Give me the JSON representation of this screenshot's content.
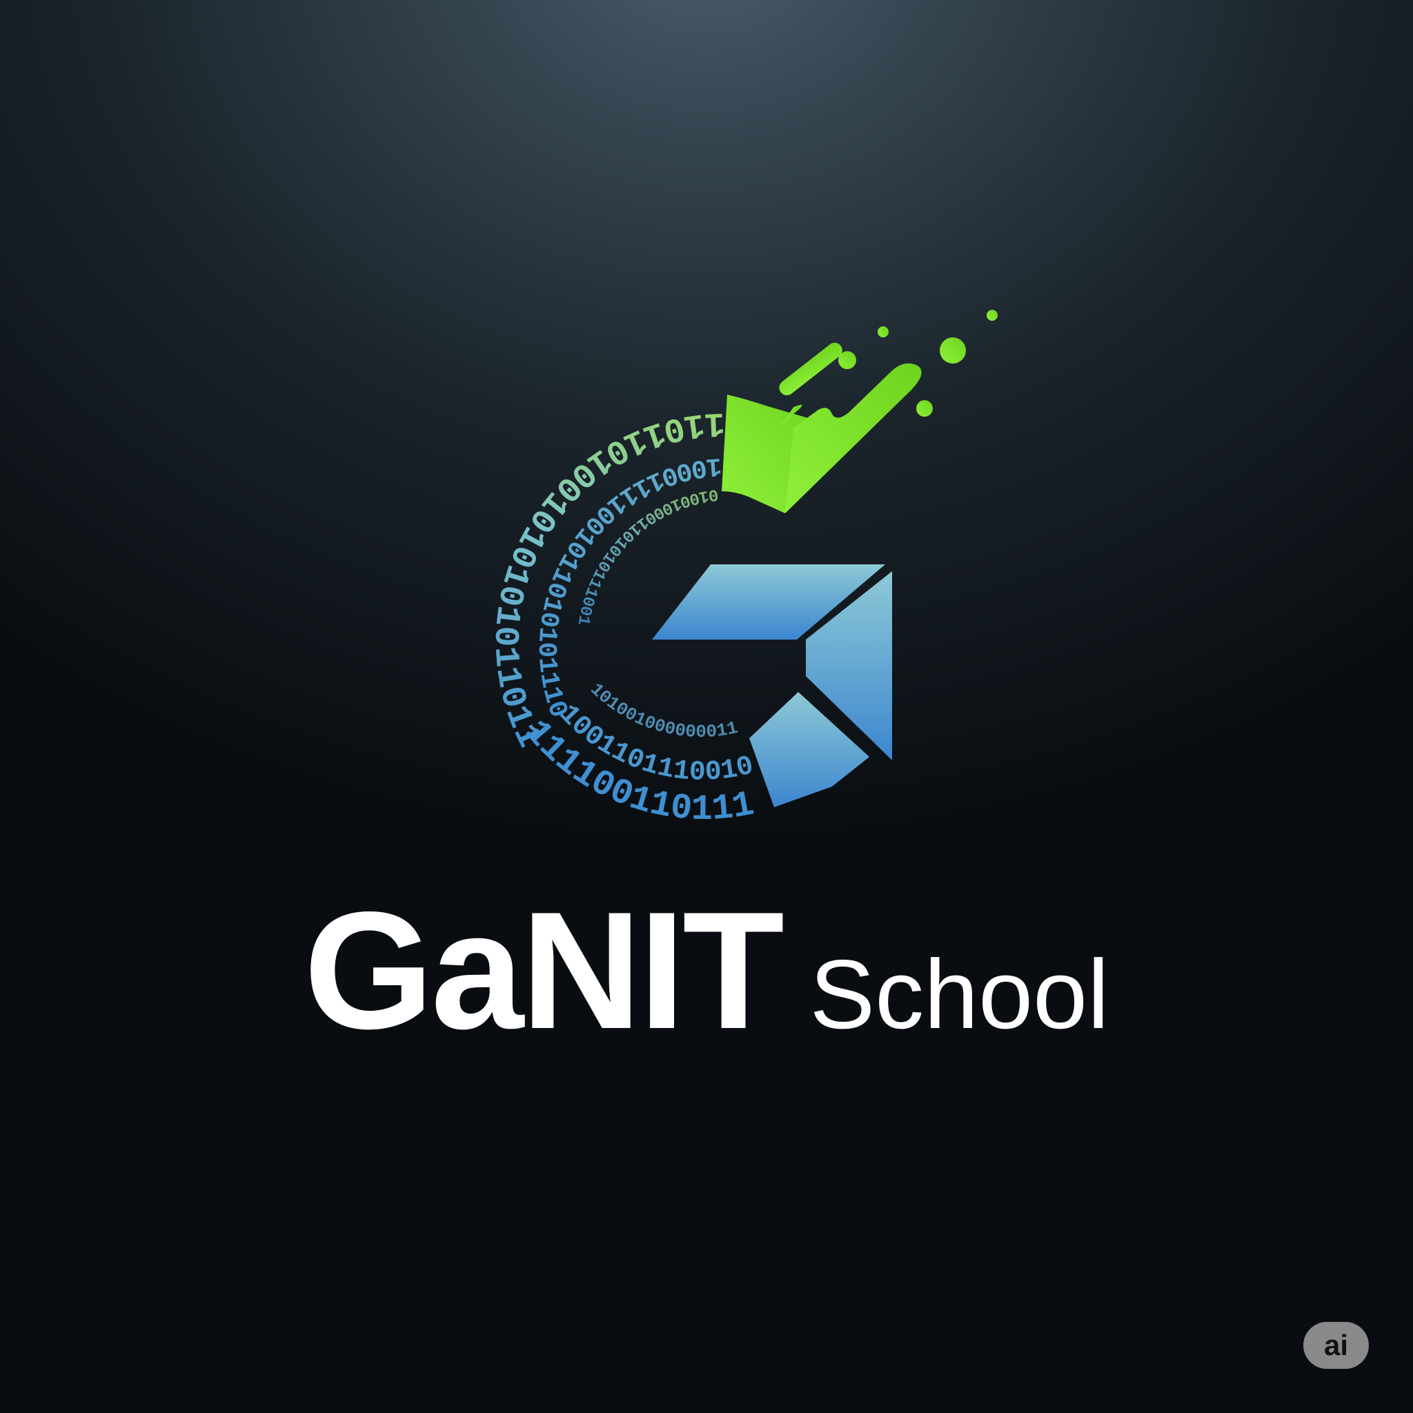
{
  "logo": {
    "brand_name": "GaNIT",
    "brand_suffix": "School",
    "binary_outer": "1101101001010101011011",
    "binary_middle": "1000111100101101010111011",
    "binary_inner": "010010001101010111001",
    "binary_lower_outer": "1111001101111001",
    "binary_lower_middle": "1001101110010110",
    "binary_lower_inner": "1010010000000111"
  },
  "badge": {
    "label": "ai"
  },
  "colors": {
    "background_top": "#4a5d6c",
    "background_bottom": "#090d11",
    "accent_green": "#7ee82a",
    "accent_blue_light": "#8ec9d6",
    "accent_blue": "#3c8ad0",
    "text": "#ffffff"
  }
}
